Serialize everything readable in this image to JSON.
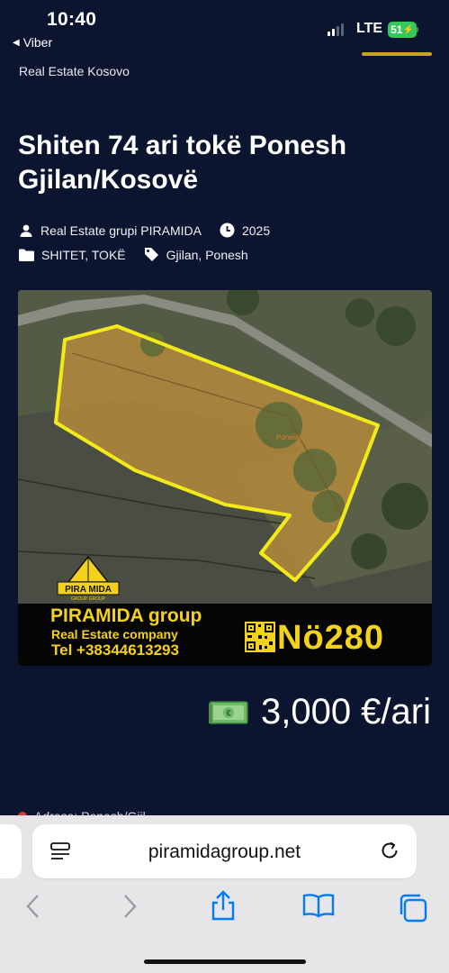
{
  "status_bar": {
    "time": "10:40",
    "back_app": "Viber",
    "network": "LTE",
    "battery": "51"
  },
  "site": {
    "name": "Real Estate Kosovo"
  },
  "article": {
    "title": "Shiten 74 ari tokë Ponesh Gjilan/Kosovë",
    "author": "Real Estate grupi PIRAMIDA",
    "year": "2025",
    "categories": "SHITET, TOKË",
    "tags": "Gjilan, Ponesh"
  },
  "hero_image": {
    "place_label": "Ponesh",
    "logo_text": "PIRA MIDA",
    "logo_subtext": "GROUP GROUP",
    "banner_title": "PIRAMIDA group",
    "banner_subtitle": "Real Estate company",
    "banner_phone": "Tel +38344613293",
    "listing_code": "Nö280"
  },
  "price": {
    "icon": "money-icon",
    "text": "3,000 €/ari"
  },
  "address_peek": {
    "text": "Adresa: Ponesh/Gjil..."
  },
  "browser": {
    "url": "piramidagroup.net",
    "icons": [
      "reader-icon",
      "reload-icon",
      "back-icon",
      "forward-icon",
      "share-icon",
      "bookmarks-icon",
      "tabs-icon"
    ]
  },
  "colors": {
    "page_bg": "#0c1530",
    "banner_yellow": "#f4d21c",
    "plot_outline": "#f2ea18",
    "battery_green": "#34c759",
    "toolbar_blue": "#007aff"
  }
}
